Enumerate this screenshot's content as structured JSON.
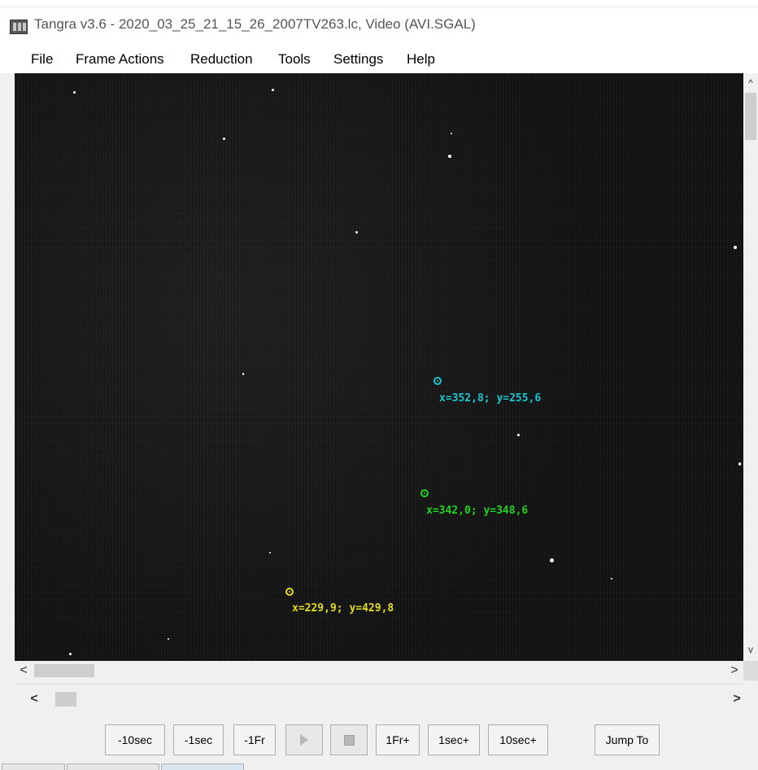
{
  "window": {
    "title": "Tangra v3.6 - 2020_03_25_21_15_26_2007TV263.lc, Video (AVI.SGAL)",
    "icon": "tangra-app-icon"
  },
  "menu": [
    {
      "label": "File"
    },
    {
      "label": "Frame Actions"
    },
    {
      "label": "Reduction"
    },
    {
      "label": "Tools"
    },
    {
      "label": "Settings"
    },
    {
      "label": "Help"
    }
  ],
  "targets": [
    {
      "id": "target-1",
      "color": "#19c4cf",
      "label": "x=352,8; y=255,6"
    },
    {
      "id": "target-2",
      "color": "#1fd31f",
      "label": "x=342,0; y=348,6"
    },
    {
      "id": "target-3",
      "color": "#e3dc1c",
      "label": "x=229,9; y=429,8"
    }
  ],
  "controls": {
    "minus10sec": "-10sec",
    "minus1sec": "-1sec",
    "minus1fr": "-1Fr",
    "play_icon": "play-icon",
    "stop_icon": "stop-icon",
    "plus1fr": "1Fr+",
    "plus1sec": "1sec+",
    "plus10sec": "10sec+",
    "jumpto": "Jump To"
  },
  "scrollbars": {
    "vertical_up": "^",
    "vertical_down": "v",
    "horizontal_left": "<",
    "horizontal_right": ">",
    "track_left": "<",
    "track_right": ">"
  }
}
